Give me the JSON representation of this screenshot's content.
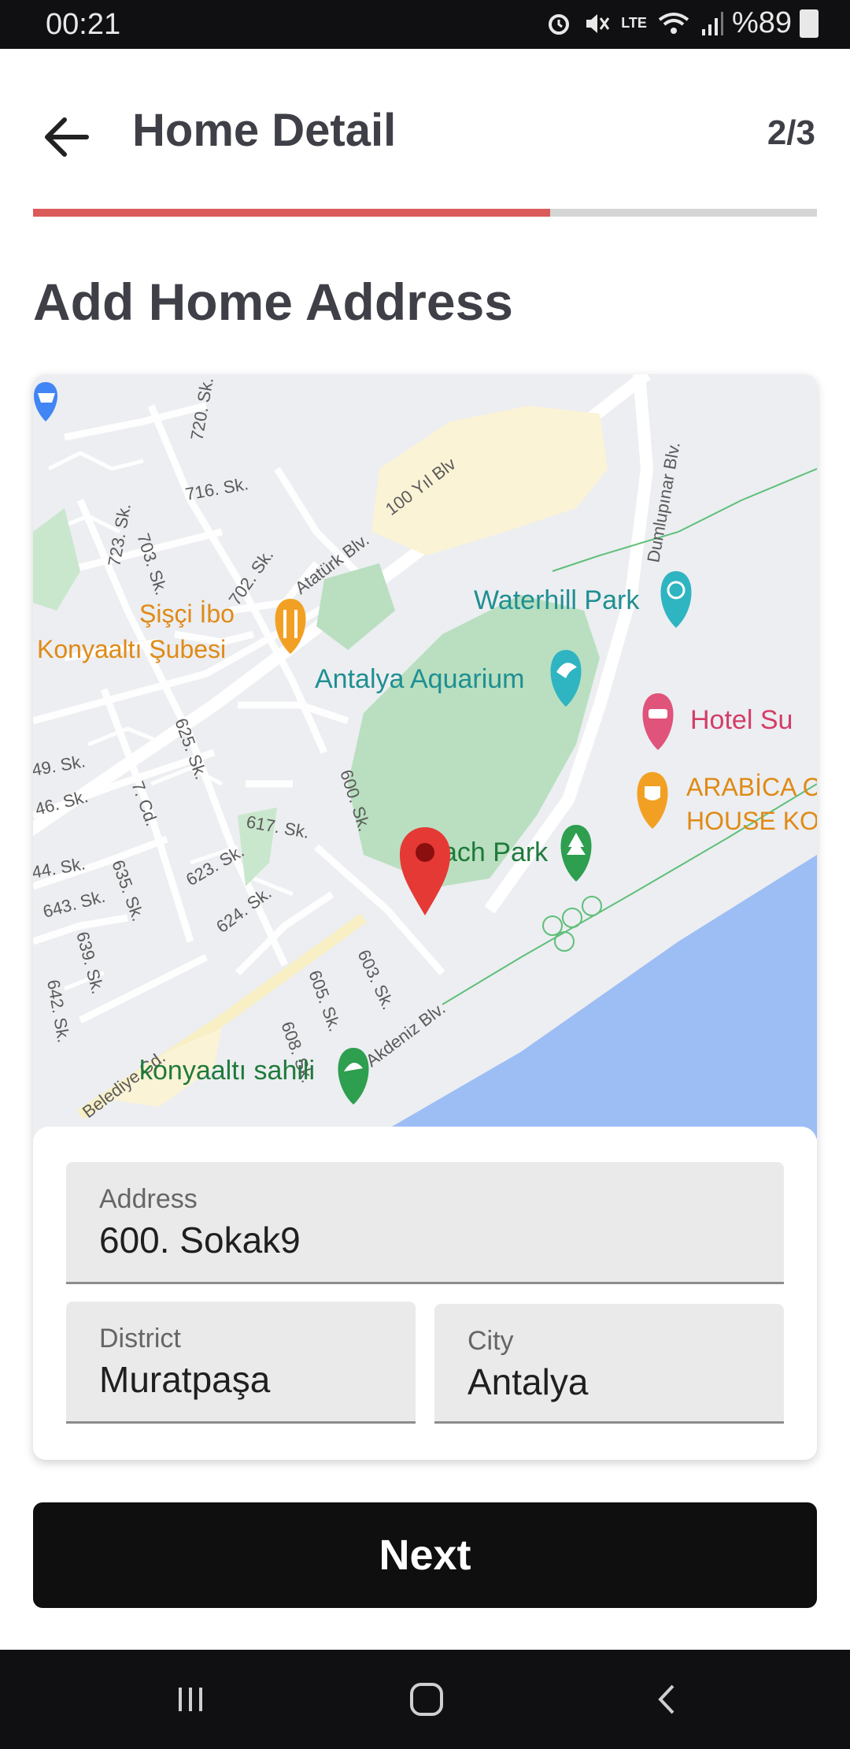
{
  "status_bar": {
    "time": "00:21",
    "battery": "%89",
    "network": "LTE"
  },
  "header": {
    "title": "Home Detail",
    "step": "2/3",
    "progress_fraction": 0.66
  },
  "section_title": "Add Home Address",
  "map": {
    "labels": {
      "sisci_ibo": "Şişçi İbo",
      "konyaalti_subesi": "Konyaaltı Şubesi",
      "waterhill_park": "Waterhill Park",
      "antalya_aquarium": "Antalya Aquarium",
      "hotel_su": "Hotel Su",
      "arabica_1": "ARABİCA C",
      "arabica_2": "HOUSE KO",
      "beach_park": "ach Park",
      "konyaalti_sahili": "konyaaltı sahili",
      "ataturk_blv": "Atatürk Blv.",
      "yil_blv": "100 Yıl Blv",
      "dumlupinar_blv": "Dumlupınar Blv.",
      "akdeniz_blv": "Akdeniz Blv.",
      "belediye_cd": "Belediye Cd.",
      "sk_720": "720. Sk.",
      "sk_716": "716. Sk.",
      "sk_723": "723. Sk.",
      "sk_703": "703. Sk.",
      "sk_702": "702. Sk.",
      "sk_625": "625. Sk.",
      "sk_600": "600. Sk.",
      "sk_617": "617. Sk.",
      "sk_623": "623. Sk.",
      "sk_624": "624. Sk.",
      "sk_7cd": "7. Cd.",
      "sk_649": "49. Sk.",
      "sk_646": "46. Sk.",
      "sk_644": "44. Sk.",
      "sk_643": "643. Sk.",
      "sk_635": "635. Sk.",
      "sk_639": "639. Sk.",
      "sk_642": "642. Sk.",
      "sk_603": "603. Sk.",
      "sk_605": "605. Sk.",
      "sk_608": "608. Sk."
    }
  },
  "form": {
    "address": {
      "label": "Address",
      "value": "600. Sokak9"
    },
    "district": {
      "label": "District",
      "value": "Muratpaşa"
    },
    "city": {
      "label": "City",
      "value": "Antalya"
    }
  },
  "next_button": {
    "label": "Next"
  },
  "colors": {
    "accent": "#db5a5a",
    "button_bg": "#0f0f10",
    "park_green": "#b9dfc0",
    "sea_blue": "#9dbdf5",
    "poi_teal": "#1f8f92",
    "poi_orange": "#e49a1e",
    "poi_pink": "#e0537a",
    "marker_red": "#e53935"
  }
}
